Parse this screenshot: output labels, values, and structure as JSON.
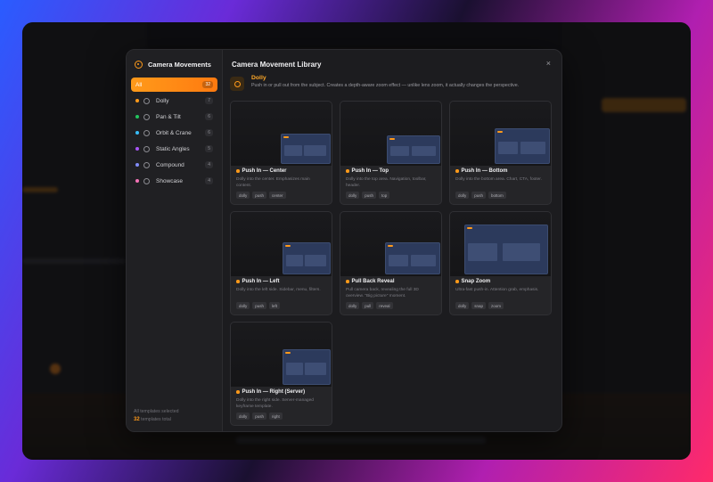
{
  "modal": {
    "sidebar_title": "Camera Movements",
    "categories": [
      {
        "label": "All",
        "count": "32",
        "color": "#ff9a1a"
      },
      {
        "label": "Dolly",
        "count": "7",
        "color": "#ff9a1a"
      },
      {
        "label": "Pan & Tilt",
        "count": "6",
        "color": "#22c55e"
      },
      {
        "label": "Orbit & Crane",
        "count": "6",
        "color": "#38bdf8"
      },
      {
        "label": "Static Angles",
        "count": "5",
        "color": "#a855f7"
      },
      {
        "label": "Compound",
        "count": "4",
        "color": "#818cf8"
      },
      {
        "label": "Showcase",
        "count": "4",
        "color": "#f472b6"
      }
    ],
    "footer_line1": "All templates selected",
    "footer_count": "32",
    "footer_suffix": "templates total",
    "title": "Camera Movement Library",
    "close": "×",
    "section": {
      "name": "Dolly",
      "description": "Push in or pull out from the subject. Creates a depth-aware zoom effect — unlike lens zoom, it actually changes the perspective."
    },
    "cards": [
      {
        "title": "Push In — Center",
        "desc": "Dolly into the center. Emphasizes main content.",
        "tags": [
          "dolly",
          "push",
          "center"
        ]
      },
      {
        "title": "Push In — Top",
        "desc": "Dolly into the top area. Navigation, toolbar, header.",
        "tags": [
          "dolly",
          "push",
          "top"
        ]
      },
      {
        "title": "Push In — Bottom",
        "desc": "Dolly into the bottom area. Chart, CTA, footer.",
        "tags": [
          "dolly",
          "push",
          "bottom"
        ]
      },
      {
        "title": "Push In — Left",
        "desc": "Dolly into the left side. Sidebar, menu, filters.",
        "tags": [
          "dolly",
          "push",
          "left"
        ]
      },
      {
        "title": "Pull Back Reveal",
        "desc": "Pull camera back, revealing the full 3D overview. \"Big picture\" moment.",
        "tags": [
          "dolly",
          "pull",
          "reveal"
        ]
      },
      {
        "title": "Snap Zoom",
        "desc": "Ultra-fast push-in. Attention grab, emphasis.",
        "tags": [
          "dolly",
          "snap",
          "zoom"
        ]
      },
      {
        "title": "Push In — Right (Server)",
        "desc": "Dolly into the right side. Server-managed keyframe template.",
        "tags": [
          "dolly",
          "push",
          "right"
        ]
      }
    ]
  }
}
